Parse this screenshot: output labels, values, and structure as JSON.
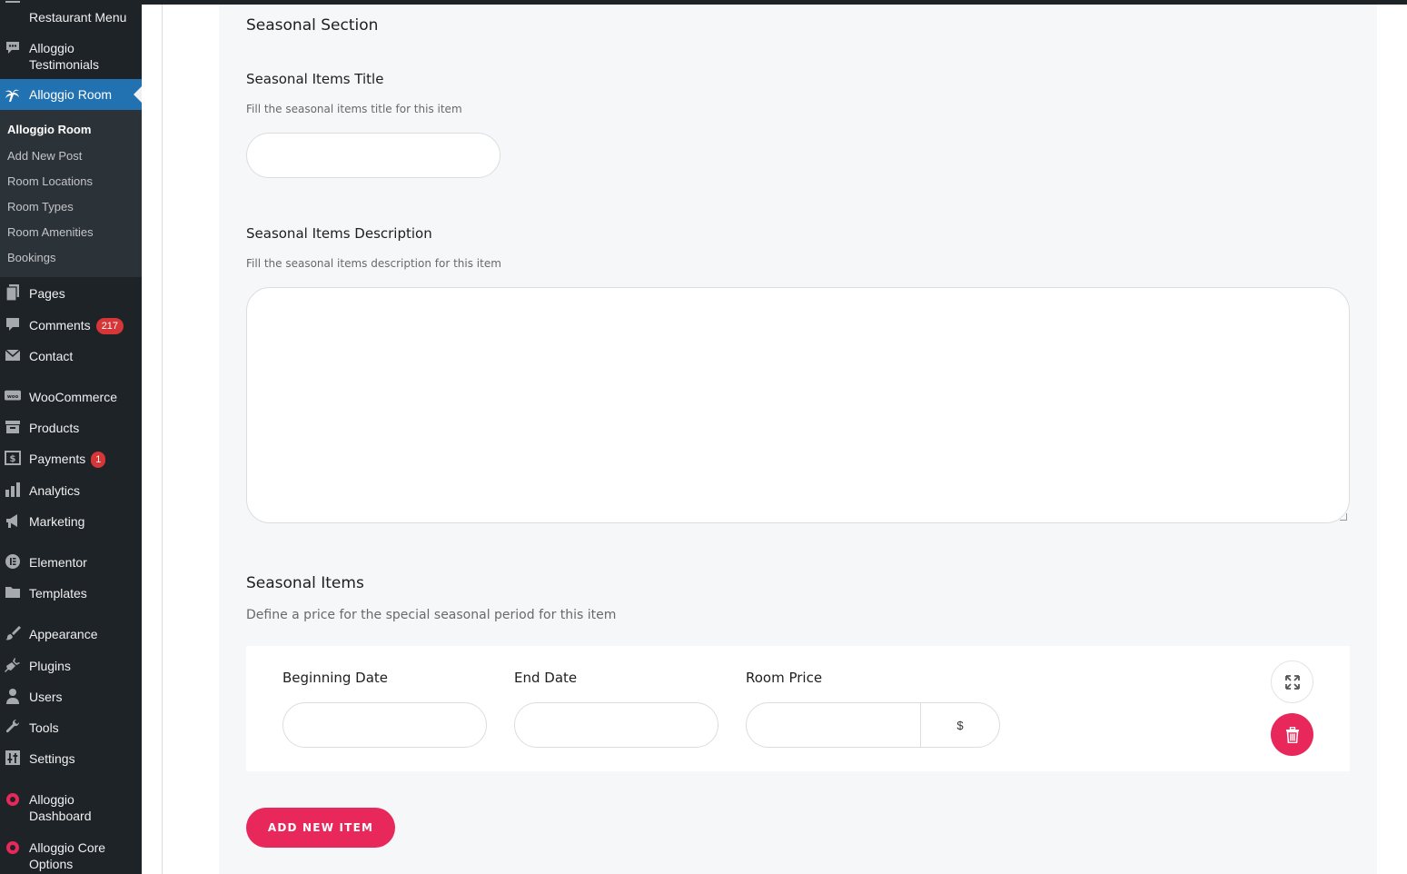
{
  "sidebar": {
    "items": [
      {
        "label": "Restaurant Menu",
        "icon": "restaurant-menu-icon"
      },
      {
        "label": "Alloggio Testimonials",
        "icon": "testimonials-icon"
      },
      {
        "label": "Alloggio Room",
        "icon": "palm-tree-icon",
        "active": true
      },
      {
        "label": "Pages",
        "icon": "pages-icon"
      },
      {
        "label": "Comments",
        "icon": "comments-icon",
        "badge": "217"
      },
      {
        "label": "Contact",
        "icon": "mail-icon"
      },
      {
        "label": "WooCommerce",
        "icon": "woocommerce-icon"
      },
      {
        "label": "Products",
        "icon": "archive-icon"
      },
      {
        "label": "Payments",
        "icon": "dollar-icon",
        "badge": "1"
      },
      {
        "label": "Analytics",
        "icon": "bar-chart-icon"
      },
      {
        "label": "Marketing",
        "icon": "megaphone-icon"
      },
      {
        "label": "Elementor",
        "icon": "elementor-icon"
      },
      {
        "label": "Templates",
        "icon": "folder-icon"
      },
      {
        "label": "Appearance",
        "icon": "paintbrush-icon"
      },
      {
        "label": "Plugins",
        "icon": "plugin-icon"
      },
      {
        "label": "Users",
        "icon": "user-icon"
      },
      {
        "label": "Tools",
        "icon": "wrench-icon"
      },
      {
        "label": "Settings",
        "icon": "settings-icon"
      },
      {
        "label": "Alloggio Dashboard",
        "icon": "alloggio-logo-icon"
      },
      {
        "label": "Alloggio Core Options",
        "icon": "alloggio-logo-icon"
      }
    ],
    "submenu": [
      {
        "label": "Alloggio Room",
        "current": true
      },
      {
        "label": "Add New Post"
      },
      {
        "label": "Room Locations"
      },
      {
        "label": "Room Types"
      },
      {
        "label": "Room Amenities"
      },
      {
        "label": "Bookings"
      }
    ]
  },
  "main": {
    "section_title": "Seasonal Section",
    "title_field": {
      "label": "Seasonal Items Title",
      "description": "Fill the seasonal items title for this item",
      "value": ""
    },
    "description_field": {
      "label": "Seasonal Items Description",
      "description": "Fill the seasonal items description for this item",
      "value": ""
    },
    "items_field": {
      "label": "Seasonal Items",
      "description": "Define a price for the special seasonal period for this item",
      "columns": {
        "beginning_date": "Beginning Date",
        "end_date": "End Date",
        "room_price": "Room Price"
      },
      "currency_suffix": "$",
      "add_button": "ADD NEW ITEM"
    }
  },
  "colors": {
    "sidebar_bg": "#1d2327",
    "active_menu": "#2271b1",
    "accent": "#e8275b",
    "panel_bg": "#f6f7f8"
  }
}
